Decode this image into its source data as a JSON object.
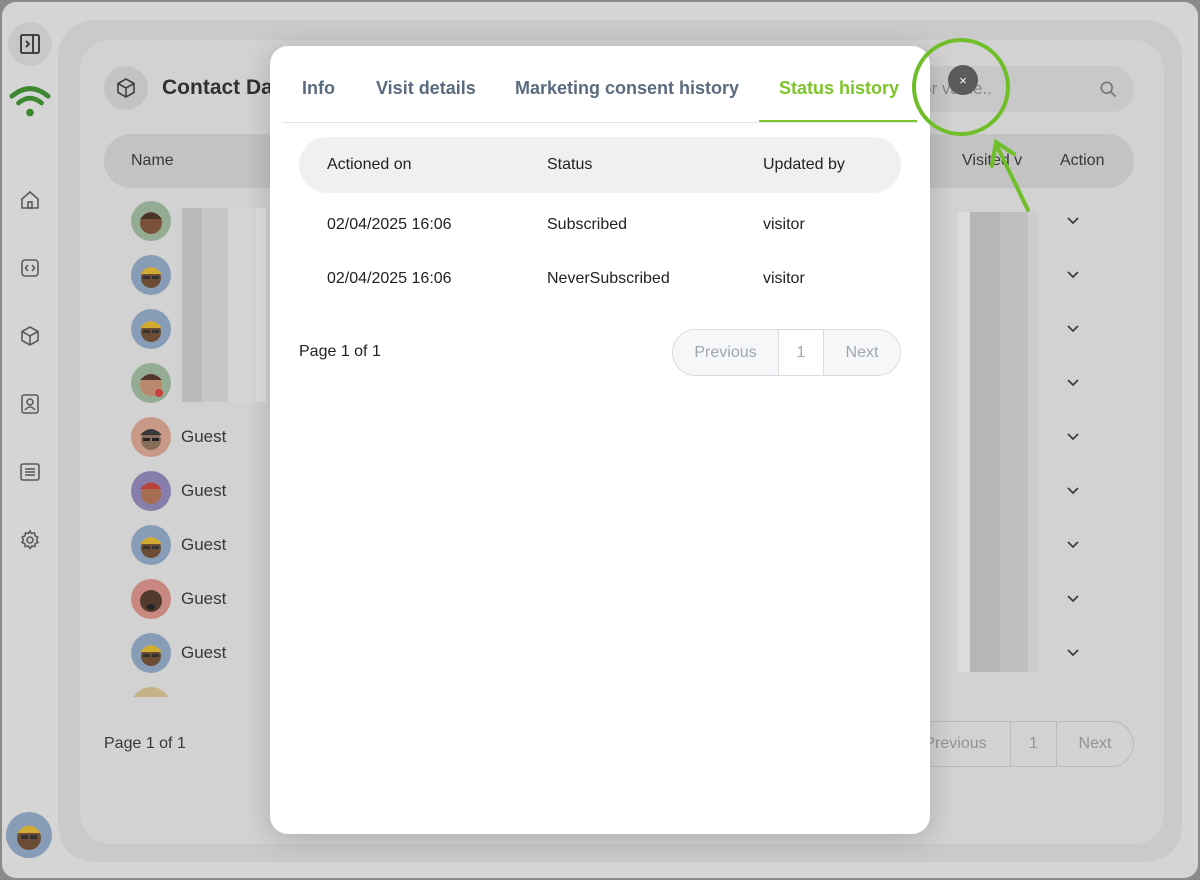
{
  "background": {
    "page_title": "Contact Da",
    "search_placeholder": "or value..",
    "table_headers": {
      "name": "Name",
      "visited": "Visited v",
      "action": "Action"
    },
    "rows": [
      {
        "name": ""
      },
      {
        "name": ""
      },
      {
        "name": ""
      },
      {
        "name": ""
      },
      {
        "name": "Guest"
      },
      {
        "name": "Guest"
      },
      {
        "name": "Guest"
      },
      {
        "name": "Guest"
      },
      {
        "name": "Guest"
      }
    ],
    "page_info": "Page 1 of 1",
    "pager": {
      "previous": "Previous",
      "page": "1",
      "next": "Next"
    }
  },
  "modal": {
    "tabs": [
      {
        "label": "Info"
      },
      {
        "label": "Visit details"
      },
      {
        "label": "Marketing consent history"
      },
      {
        "label": "Status history",
        "active": true
      }
    ],
    "close_label": "×",
    "table_headers": {
      "actioned_on": "Actioned on",
      "status": "Status",
      "updated_by": "Updated by"
    },
    "rows": [
      {
        "actioned_on": "02/04/2025 16:06",
        "status": "Subscribed",
        "updated_by": "visitor"
      },
      {
        "actioned_on": "02/04/2025 16:06",
        "status": "NeverSubscribed",
        "updated_by": "visitor"
      }
    ],
    "page_info": "Page 1 of 1",
    "pager": {
      "previous": "Previous",
      "page": "1",
      "next": "Next"
    }
  },
  "colors": {
    "accent": "#7cc52a",
    "tab_inactive": "#5b6b7f",
    "close_button": "#5b5b5b"
  }
}
